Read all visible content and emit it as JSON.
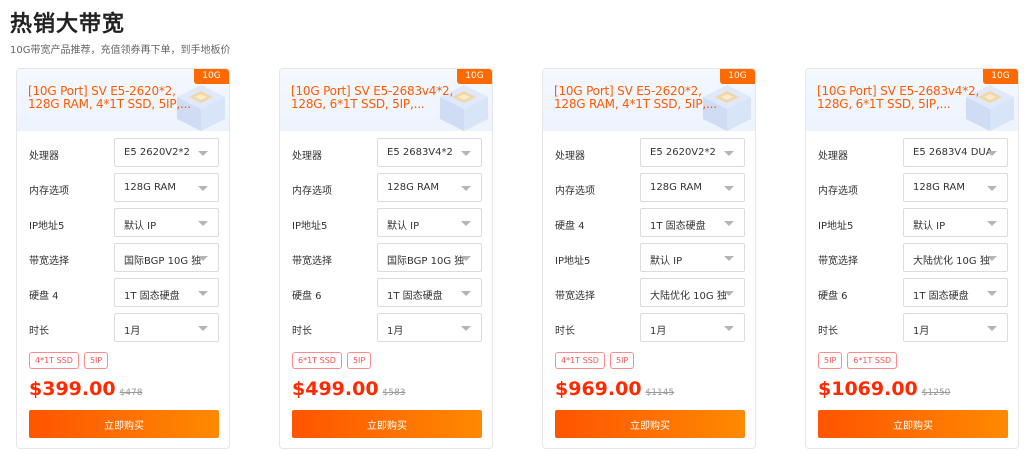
{
  "page": {
    "title": "热销大带宽",
    "subtitle": "10G带宽产品推荐，充值领券再下单，到手地板价"
  },
  "colors": {
    "accent": "#ff6a00",
    "price": "#ff2a00",
    "tag": "#ff5050"
  },
  "cards": [
    {
      "badge": "10G",
      "title": "[10G Port] SV E5-2620*2, 128G RAM, 4*1T SSD, 5IP,...",
      "rows": [
        {
          "label": "处理器",
          "value": "E5 2620V2*2"
        },
        {
          "label": "内存选项",
          "value": "128G RAM"
        },
        {
          "label": "IP地址5",
          "value": "默认 IP"
        },
        {
          "label": "带宽选择",
          "value": "国际BGP 10G 独"
        },
        {
          "label": "硬盘 4",
          "value": "1T 固态硬盘"
        },
        {
          "label": "时长",
          "value": "1月"
        }
      ],
      "tags": [
        "4*1T SSD",
        "5IP"
      ],
      "price": "$399.00",
      "original_price": "$478",
      "buy_label": "立即购买"
    },
    {
      "badge": "10G",
      "title": "[10G Port] SV E5-2683v4*2, 128G, 6*1T SSD, 5IP,...",
      "rows": [
        {
          "label": "处理器",
          "value": "E5 2683V4*2"
        },
        {
          "label": "内存选项",
          "value": "128G RAM"
        },
        {
          "label": "IP地址5",
          "value": "默认 IP"
        },
        {
          "label": "带宽选择",
          "value": "国际BGP 10G 独"
        },
        {
          "label": "硬盘 6",
          "value": "1T 固态硬盘"
        },
        {
          "label": "时长",
          "value": "1月"
        }
      ],
      "tags": [
        "6*1T SSD",
        "5IP"
      ],
      "price": "$499.00",
      "original_price": "$583",
      "buy_label": "立即购买"
    },
    {
      "badge": "10G",
      "title": "[10G Port] SV E5-2620*2, 128G RAM, 4*1T SSD, 5IP,...",
      "rows": [
        {
          "label": "处理器",
          "value": "E5 2620V2*2"
        },
        {
          "label": "内存选项",
          "value": "128G RAM"
        },
        {
          "label": "硬盘 4",
          "value": "1T 固态硬盘"
        },
        {
          "label": "IP地址5",
          "value": "默认 IP"
        },
        {
          "label": "带宽选择",
          "value": "大陆优化 10G 独"
        },
        {
          "label": "时长",
          "value": "1月"
        }
      ],
      "tags": [
        "4*1T SSD",
        "5IP"
      ],
      "price": "$969.00",
      "original_price": "$1145",
      "buy_label": "立即购买"
    },
    {
      "badge": "10G",
      "title": "[10G Port] SV E5-2683v4*2, 128G, 6*1T SSD, 5IP,...",
      "rows": [
        {
          "label": "处理器",
          "value": "E5 2683V4 DUA"
        },
        {
          "label": "内存选项",
          "value": "128G RAM"
        },
        {
          "label": "IP地址5",
          "value": "默认 IP"
        },
        {
          "label": "带宽选择",
          "value": "大陆优化 10G 独"
        },
        {
          "label": "硬盘 6",
          "value": "1T 固态硬盘"
        },
        {
          "label": "时长",
          "value": "1月"
        }
      ],
      "tags": [
        "5IP",
        "6*1T SSD"
      ],
      "price": "$1069.00",
      "original_price": "$1250",
      "buy_label": "立即购买"
    }
  ]
}
